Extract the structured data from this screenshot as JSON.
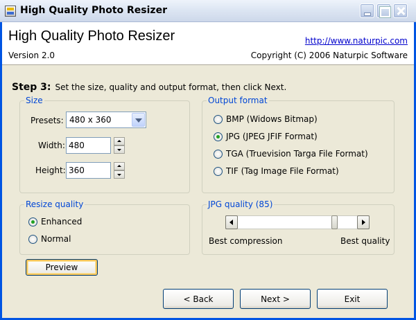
{
  "window": {
    "title": "High Quality Photo Resizer"
  },
  "header": {
    "app_name": "High Quality Photo Resizer",
    "version": "Version 2.0",
    "url": "http://www.naturpic.com",
    "copyright": "Copyright (C) 2006 Naturpic Software"
  },
  "step": {
    "label": "Step 3:",
    "instruction": "Set the size, quality and output format, then click Next."
  },
  "size": {
    "group_label": "Size",
    "presets_label": "Presets:",
    "presets_value": "480 x 360",
    "width_label": "Width:",
    "width_value": "480",
    "height_label": "Height:",
    "height_value": "360"
  },
  "output_format": {
    "group_label": "Output format",
    "options": [
      {
        "label": "BMP (Widows Bitmap)",
        "selected": false
      },
      {
        "label": "JPG (JPEG JFIF Format)",
        "selected": true
      },
      {
        "label": "TGA (Truevision Targa File Format)",
        "selected": false
      },
      {
        "label": "TIF (Tag Image File Format)",
        "selected": false
      }
    ]
  },
  "resize_quality": {
    "group_label": "Resize quality",
    "options": [
      {
        "label": "Enhanced",
        "selected": true
      },
      {
        "label": "Normal",
        "selected": false
      }
    ]
  },
  "jpg_quality": {
    "group_label": "JPG quality (85)",
    "value": 85,
    "min_label": "Best compression",
    "max_label": "Best quality"
  },
  "buttons": {
    "preview": "Preview",
    "back": "< Back",
    "next": "Next >",
    "exit": "Exit"
  }
}
